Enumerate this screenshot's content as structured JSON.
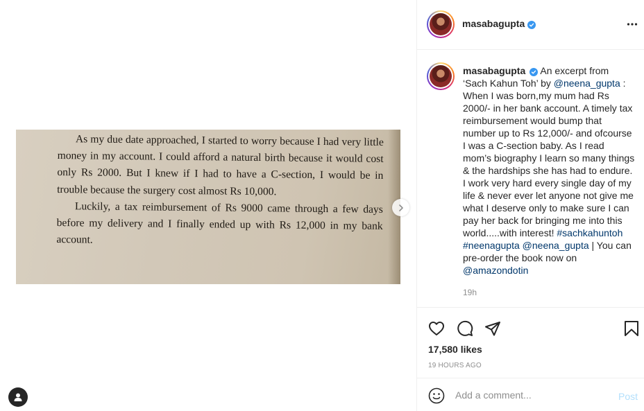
{
  "post": {
    "image_text": {
      "paragraph1": "As my due date approached, I started to worry because I had very little money in my account. I could afford a natural birth because it would cost only Rs 2000. But I knew if I had to have a C-section, I would be in trouble because the surgery cost almost Rs 10,000.",
      "paragraph2": "Luckily, a tax reimbursement of Rs 9000 came through a few days before my delivery and I finally ended up with Rs 12,000 in my bank account."
    }
  },
  "header": {
    "username": "masabagupta",
    "more_label": "•••"
  },
  "caption": {
    "username": "masabagupta",
    "text1": "An excerpt from ‘Sach Kahun Toh’ by ",
    "mention1": "@neena_gupta",
    "text2": " : When I was born,my mum had Rs 2000/- in her bank account. A timely tax reimbursement would bump that number up to Rs 12,000/- and ofcourse I was a C-section baby. As I read mom’s biography I learn so many things & the hardships she has had to endure. I work very hard every single day of my life & never ever let anyone not give me what I deserve only to make sure I can pay her back for bringing me into this world.....with interest! ",
    "hashtag1": "#sachkahuntoh",
    "space": " ",
    "hashtag2": "#neenagupta",
    "mention2": "@neena_gupta",
    "text3": " | You can pre-order the book now on ",
    "mention3": "@amazondotin",
    "time": "19h"
  },
  "engagement": {
    "likes": "17,580 likes",
    "timestamp": "19 HOURS AGO"
  },
  "comment": {
    "placeholder": "Add a comment...",
    "post_label": "Post"
  },
  "colors": {
    "link": "#00376b",
    "verified": "#3897f0",
    "post_disabled": "#b2dffc"
  }
}
